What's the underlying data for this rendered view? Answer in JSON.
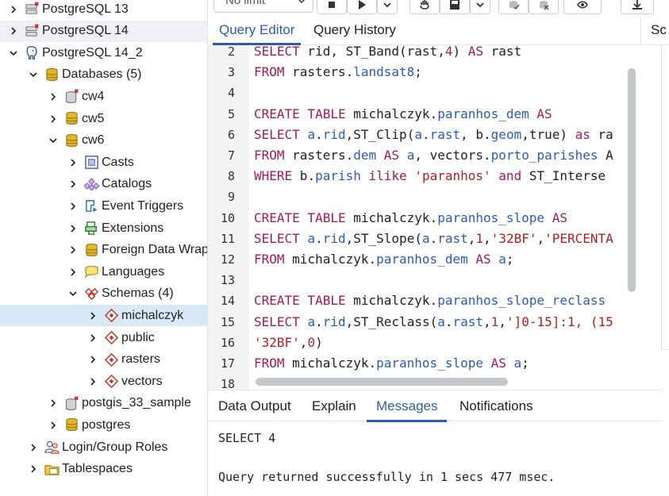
{
  "tree": [
    {
      "depth": 0,
      "label": "PostgreSQL 13",
      "icon": "server-disconnected-icon",
      "expanded": false
    },
    {
      "depth": 0,
      "label": "PostgreSQL 14",
      "icon": "server-disconnected-icon",
      "expanded": false,
      "state": "hover"
    },
    {
      "depth": 0,
      "label": "PostgreSQL 14_2",
      "icon": "postgres-elephant-icon",
      "expanded": true
    },
    {
      "depth": 1,
      "label": "Databases (5)",
      "icon": "databases-icon",
      "expanded": true
    },
    {
      "depth": 2,
      "label": "cw4",
      "icon": "database-disconnected-icon",
      "expanded": false
    },
    {
      "depth": 2,
      "label": "cw5",
      "icon": "database-icon",
      "expanded": false
    },
    {
      "depth": 2,
      "label": "cw6",
      "icon": "database-icon",
      "expanded": true
    },
    {
      "depth": 3,
      "label": "Casts",
      "icon": "casts-icon",
      "expanded": false
    },
    {
      "depth": 3,
      "label": "Catalogs",
      "icon": "catalogs-icon",
      "expanded": false
    },
    {
      "depth": 3,
      "label": "Event Triggers",
      "icon": "event-triggers-icon",
      "expanded": false
    },
    {
      "depth": 3,
      "label": "Extensions",
      "icon": "extensions-icon",
      "expanded": false
    },
    {
      "depth": 3,
      "label": "Foreign Data Wrap",
      "icon": "foreign-data-wrapper-icon",
      "expanded": false
    },
    {
      "depth": 3,
      "label": "Languages",
      "icon": "languages-icon",
      "expanded": false
    },
    {
      "depth": 3,
      "label": "Schemas (4)",
      "icon": "schemas-icon",
      "expanded": true
    },
    {
      "depth": 4,
      "label": "michalczyk",
      "icon": "schema-icon",
      "expanded": false,
      "state": "selected"
    },
    {
      "depth": 4,
      "label": "public",
      "icon": "schema-icon",
      "expanded": false
    },
    {
      "depth": 4,
      "label": "rasters",
      "icon": "schema-icon",
      "expanded": false
    },
    {
      "depth": 4,
      "label": "vectors",
      "icon": "schema-icon",
      "expanded": false
    },
    {
      "depth": 2,
      "label": "postgis_33_sample",
      "icon": "database-disconnected-icon",
      "expanded": false
    },
    {
      "depth": 2,
      "label": "postgres",
      "icon": "database-icon",
      "expanded": false
    },
    {
      "depth": 1,
      "label": "Login/Group Roles",
      "icon": "login-roles-icon",
      "expanded": false
    },
    {
      "depth": 1,
      "label": "Tablespaces",
      "icon": "tablespaces-icon",
      "expanded": false
    }
  ],
  "toolbar": {
    "limit_select": "No limit",
    "buttons": [
      {
        "name": "stop-button",
        "icon": "stop-icon"
      },
      {
        "name": "execute-button",
        "icon": "play-icon"
      },
      {
        "name": "execute-options-button",
        "icon": "chevron-down-icon"
      },
      {
        "name": "explain-button",
        "icon": "hand-icon"
      },
      {
        "name": "save-button",
        "icon": "save-icon"
      },
      {
        "name": "save-options-button",
        "icon": "chevron-down-icon"
      },
      {
        "name": "commit-button",
        "icon": "commit-icon"
      },
      {
        "name": "rollback-button",
        "icon": "rollback-icon"
      },
      {
        "name": "clear-button",
        "icon": "eraser-icon"
      },
      {
        "name": "download-button",
        "icon": "download-icon"
      }
    ]
  },
  "editor_tabs": [
    {
      "label": "Query Editor",
      "active": true
    },
    {
      "label": "Query History",
      "active": false
    }
  ],
  "side_tab": "Sc",
  "code_lines": [
    {
      "n": "2",
      "tokens": [
        [
          "kw",
          "SELECT"
        ],
        [
          "fn",
          " rid, ST_Band(rast,"
        ],
        [
          "num",
          "4"
        ],
        [
          "fn",
          ") "
        ],
        [
          "kw",
          "AS"
        ],
        [
          "fn",
          " rast"
        ]
      ]
    },
    {
      "n": "3",
      "tokens": [
        [
          "kw",
          "FROM"
        ],
        [
          "fn",
          " rasters."
        ],
        [
          "id",
          "landsat8"
        ],
        [
          "fn",
          ";"
        ]
      ]
    },
    {
      "n": "4",
      "tokens": []
    },
    {
      "n": "5",
      "tokens": [
        [
          "kw",
          "CREATE TABLE"
        ],
        [
          "fn",
          " michalczyk."
        ],
        [
          "id",
          "paranhos_dem"
        ],
        [
          "fn",
          " "
        ],
        [
          "kw",
          "AS"
        ]
      ]
    },
    {
      "n": "6",
      "tokens": [
        [
          "kw",
          "SELECT"
        ],
        [
          "fn",
          " "
        ],
        [
          "id",
          "a"
        ],
        [
          "fn",
          "."
        ],
        [
          "id",
          "rid"
        ],
        [
          "fn",
          ",ST_Clip("
        ],
        [
          "id",
          "a"
        ],
        [
          "fn",
          "."
        ],
        [
          "id",
          "rast"
        ],
        [
          "fn",
          ", b."
        ],
        [
          "id",
          "geom"
        ],
        [
          "fn",
          ",true) "
        ],
        [
          "kw",
          "as"
        ],
        [
          "fn",
          " ra"
        ]
      ]
    },
    {
      "n": "7",
      "tokens": [
        [
          "kw",
          "FROM"
        ],
        [
          "fn",
          " rasters."
        ],
        [
          "id",
          "dem"
        ],
        [
          "fn",
          " "
        ],
        [
          "kw",
          "AS"
        ],
        [
          "fn",
          " "
        ],
        [
          "id",
          "a"
        ],
        [
          "fn",
          ", vectors."
        ],
        [
          "id",
          "porto_parishes"
        ],
        [
          "fn",
          " A"
        ]
      ]
    },
    {
      "n": "8",
      "tokens": [
        [
          "kw",
          "WHERE"
        ],
        [
          "fn",
          " b."
        ],
        [
          "id",
          "parish"
        ],
        [
          "fn",
          " "
        ],
        [
          "kw",
          "ilike"
        ],
        [
          "fn",
          " "
        ],
        [
          "str",
          "'paranhos'"
        ],
        [
          "fn",
          " "
        ],
        [
          "kw",
          "and"
        ],
        [
          "fn",
          " ST_Interse"
        ]
      ]
    },
    {
      "n": "9",
      "tokens": []
    },
    {
      "n": "10",
      "tokens": [
        [
          "kw",
          "CREATE TABLE"
        ],
        [
          "fn",
          " michalczyk."
        ],
        [
          "id",
          "paranhos_slope"
        ],
        [
          "fn",
          " "
        ],
        [
          "kw",
          "AS"
        ]
      ]
    },
    {
      "n": "11",
      "tokens": [
        [
          "kw",
          "SELECT"
        ],
        [
          "fn",
          " "
        ],
        [
          "id",
          "a"
        ],
        [
          "fn",
          "."
        ],
        [
          "id",
          "rid"
        ],
        [
          "fn",
          ",ST_Slope("
        ],
        [
          "id",
          "a"
        ],
        [
          "fn",
          "."
        ],
        [
          "id",
          "rast"
        ],
        [
          "fn",
          ","
        ],
        [
          "num",
          "1"
        ],
        [
          "fn",
          ","
        ],
        [
          "str",
          "'32BF'"
        ],
        [
          "fn",
          ","
        ],
        [
          "str",
          "'PERCENTA"
        ]
      ]
    },
    {
      "n": "12",
      "tokens": [
        [
          "kw",
          "FROM"
        ],
        [
          "fn",
          " michalczyk."
        ],
        [
          "id",
          "paranhos_dem"
        ],
        [
          "fn",
          " "
        ],
        [
          "kw",
          "AS"
        ],
        [
          "fn",
          " "
        ],
        [
          "id",
          "a"
        ],
        [
          "fn",
          ";"
        ]
      ]
    },
    {
      "n": "13",
      "tokens": []
    },
    {
      "n": "14",
      "tokens": [
        [
          "kw",
          "CREATE TABLE"
        ],
        [
          "fn",
          " michalczyk."
        ],
        [
          "id",
          "paranhos_slope_reclass"
        ]
      ]
    },
    {
      "n": "15",
      "tokens": [
        [
          "kw",
          "SELECT"
        ],
        [
          "fn",
          " "
        ],
        [
          "id",
          "a"
        ],
        [
          "fn",
          "."
        ],
        [
          "id",
          "rid"
        ],
        [
          "fn",
          ",ST_Reclass("
        ],
        [
          "id",
          "a"
        ],
        [
          "fn",
          "."
        ],
        [
          "id",
          "rast"
        ],
        [
          "fn",
          ","
        ],
        [
          "num",
          "1"
        ],
        [
          "fn",
          ","
        ],
        [
          "str",
          "']0-15]:1, (15"
        ]
      ]
    },
    {
      "n": "16",
      "tokens": [
        [
          "str",
          "'32BF'"
        ],
        [
          "fn",
          ","
        ],
        [
          "num",
          "0"
        ],
        [
          "fn",
          ")"
        ]
      ]
    },
    {
      "n": "17",
      "tokens": [
        [
          "kw",
          "FROM"
        ],
        [
          "fn",
          " michalczyk."
        ],
        [
          "id",
          "paranhos_slope"
        ],
        [
          "fn",
          " "
        ],
        [
          "kw",
          "AS"
        ],
        [
          "fn",
          " "
        ],
        [
          "id",
          "a"
        ],
        [
          "fn",
          ";"
        ]
      ]
    },
    {
      "n": "18",
      "tokens": []
    }
  ],
  "output_tabs": [
    {
      "label": "Data Output",
      "active": false
    },
    {
      "label": "Explain",
      "active": false
    },
    {
      "label": "Messages",
      "active": true
    },
    {
      "label": "Notifications",
      "active": false
    }
  ],
  "messages": [
    "SELECT 4",
    "",
    "Query returned successfully in 1 secs 477 msec."
  ],
  "colors": {
    "accent": "#2c5cb4",
    "keyword": "#a01b5a",
    "string": "#b21f1f",
    "selected_row": "#d9e9f7"
  }
}
